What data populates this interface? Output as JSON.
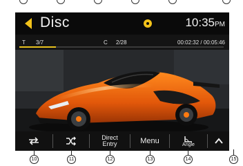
{
  "header": {
    "title": "Disc",
    "clock": "10:35",
    "clock_ampm": "PM"
  },
  "info": {
    "track_label": "T",
    "track_value": "3/7",
    "chapter_label": "C",
    "chapter_value": "2/28",
    "time": "00:02:32 / 00:05:46",
    "progress": 0.18
  },
  "colors": {
    "accent": "#f2c21a",
    "background": "#000000",
    "bar": "#111111"
  },
  "buttons": {
    "repeat_icon": "repeat-icon",
    "shuffle_icon": "shuffle-icon",
    "direct_entry": "Direct\nEntry",
    "direct_entry_line1": "Direct",
    "direct_entry_line2": "Entry",
    "menu": "Menu",
    "angle_label": "Angle",
    "up_icon": "chevron-up-icon"
  },
  "callouts": [
    "10",
    "11",
    "12",
    "13",
    "14",
    "15"
  ]
}
